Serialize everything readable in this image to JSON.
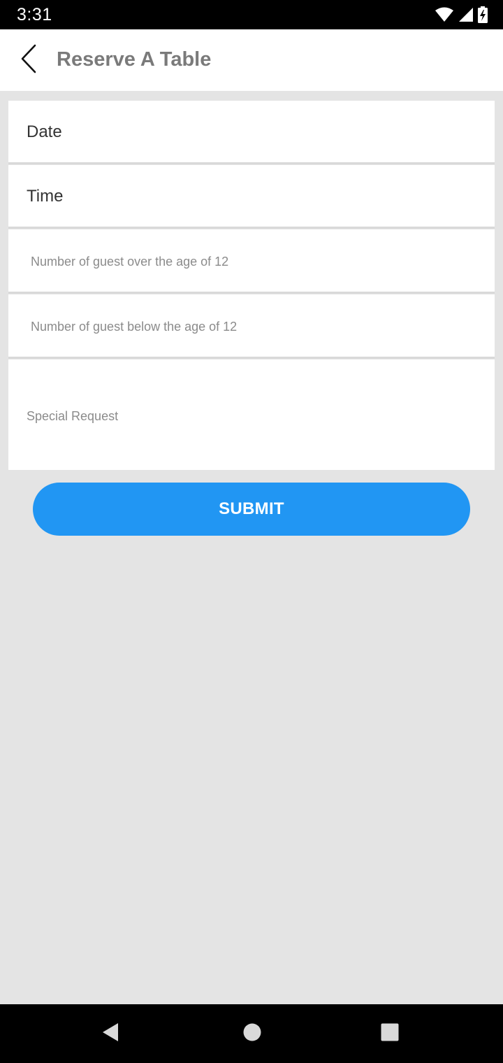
{
  "status_bar": {
    "time": "3:31",
    "icons": [
      "wifi-icon",
      "signal-icon",
      "battery-icon"
    ]
  },
  "app_bar": {
    "title": "Reserve A Table",
    "back_icon": "chevron-left-icon"
  },
  "form": {
    "date_label": "Date",
    "time_label": "Time",
    "guests_over_12_placeholder": "Number of guest over the age of 12",
    "guests_below_12_placeholder": "Number of guest below the age of 12",
    "special_request_placeholder": "Special Request"
  },
  "submit": {
    "label": "SUBMIT"
  },
  "nav_bar": {
    "icons": [
      "back-triangle-icon",
      "home-circle-icon",
      "recents-square-icon"
    ]
  },
  "colors": {
    "accent": "#2196f3",
    "background": "#e4e4e4",
    "title_gray": "#7a7a7a"
  }
}
